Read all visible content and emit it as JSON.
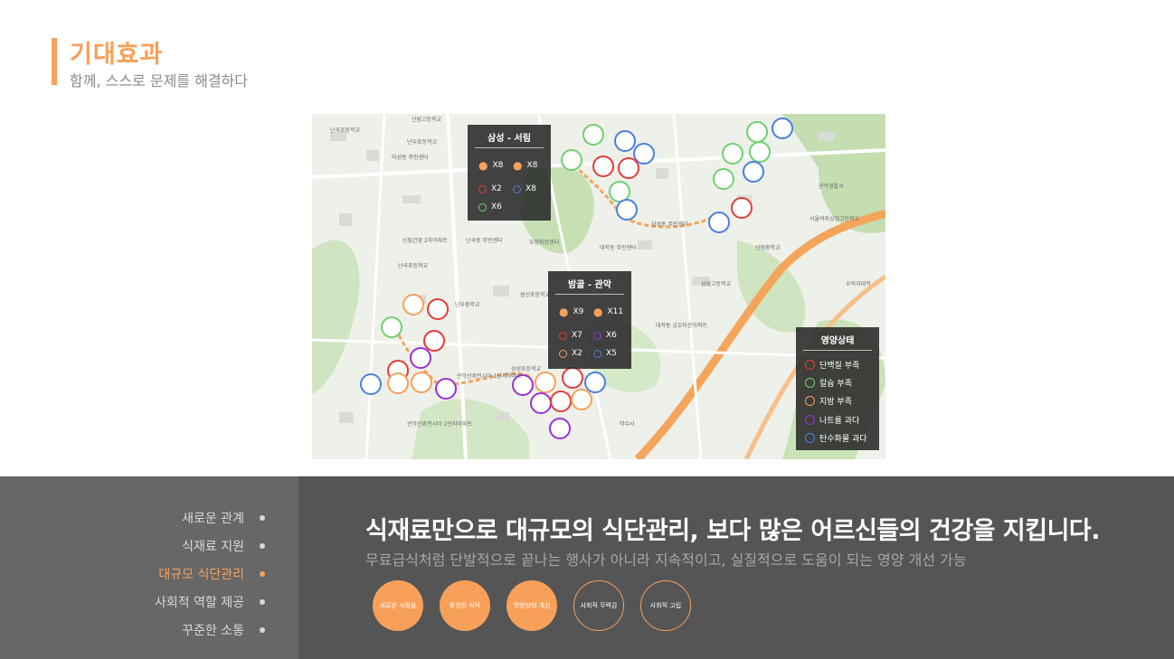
{
  "header": {
    "title": "기대효과",
    "subtitle": "함께, 스스로 문제를 해결하다"
  },
  "map": {
    "labels": [
      "신림고등학교",
      "난곡초등학교",
      "난우초등학교",
      "미성동 주민센터",
      "신림건영 2차아파트",
      "난곡동 주민센터",
      "난곡초등학교",
      "우정취업센터",
      "대학동 주민센터",
      "삼성동 주민센터",
      "삼성고등학교",
      "신림중학교",
      "관악경찰서",
      "서울여자상업고등학교",
      "원신초등학교",
      "대학동 금호타운아파트",
      "관악산휴먼시아 2단지아파트",
      "약수사",
      "삼성초등학교",
      "수의과대학",
      "난우중학교",
      "관악산휴먼시아 1단지아파트"
    ],
    "boxes": [
      {
        "title": "삼성 - 서림",
        "counts": [
          "X8",
          "X8"
        ],
        "rings": [
          [
            "X2",
            "X8"
          ],
          [
            "X6"
          ]
        ]
      },
      {
        "title": "밤골 - 관악",
        "counts": [
          "X9",
          "X11"
        ],
        "rings": [
          [
            "X7",
            "X6"
          ],
          [
            "X2",
            "X5"
          ]
        ]
      }
    ],
    "legend": {
      "title": "영양상태",
      "items": [
        {
          "label": "단백질 부족",
          "color": "#e53a3a"
        },
        {
          "label": "칼슘 부족",
          "color": "#6fd06f"
        },
        {
          "label": "지방 부족",
          "color": "#f7a05a"
        },
        {
          "label": "나트륨 과다",
          "color": "#9b30d8"
        },
        {
          "label": "탄수화물 과다",
          "color": "#4a7fe0"
        }
      ]
    }
  },
  "nav": {
    "items": [
      {
        "label": "새로운 관계"
      },
      {
        "label": "식재료 지원"
      },
      {
        "label": "대규모 식단관리"
      },
      {
        "label": "사회적 역할 제공"
      },
      {
        "label": "꾸준한 소통"
      }
    ]
  },
  "main": {
    "headline": "식재료만으로 대규모의 식단관리, 보다 많은 어르신들의 건강을 지킵니다.",
    "subline": "무료급식처럼 단발적으로 끝나는 행사가 아니라 지속적이고, 실질적으로 도움이 되는 영양 개선 가능",
    "circles": [
      {
        "label": "새로운 사람들"
      },
      {
        "label": "풍성한 식탁"
      },
      {
        "label": "영양상태 개선"
      },
      {
        "label": "사회적 무력감"
      },
      {
        "label": "사회적 고립"
      }
    ]
  },
  "colors": {
    "accent": "#f7a05a",
    "dark": "#555555",
    "side": "#676767"
  }
}
